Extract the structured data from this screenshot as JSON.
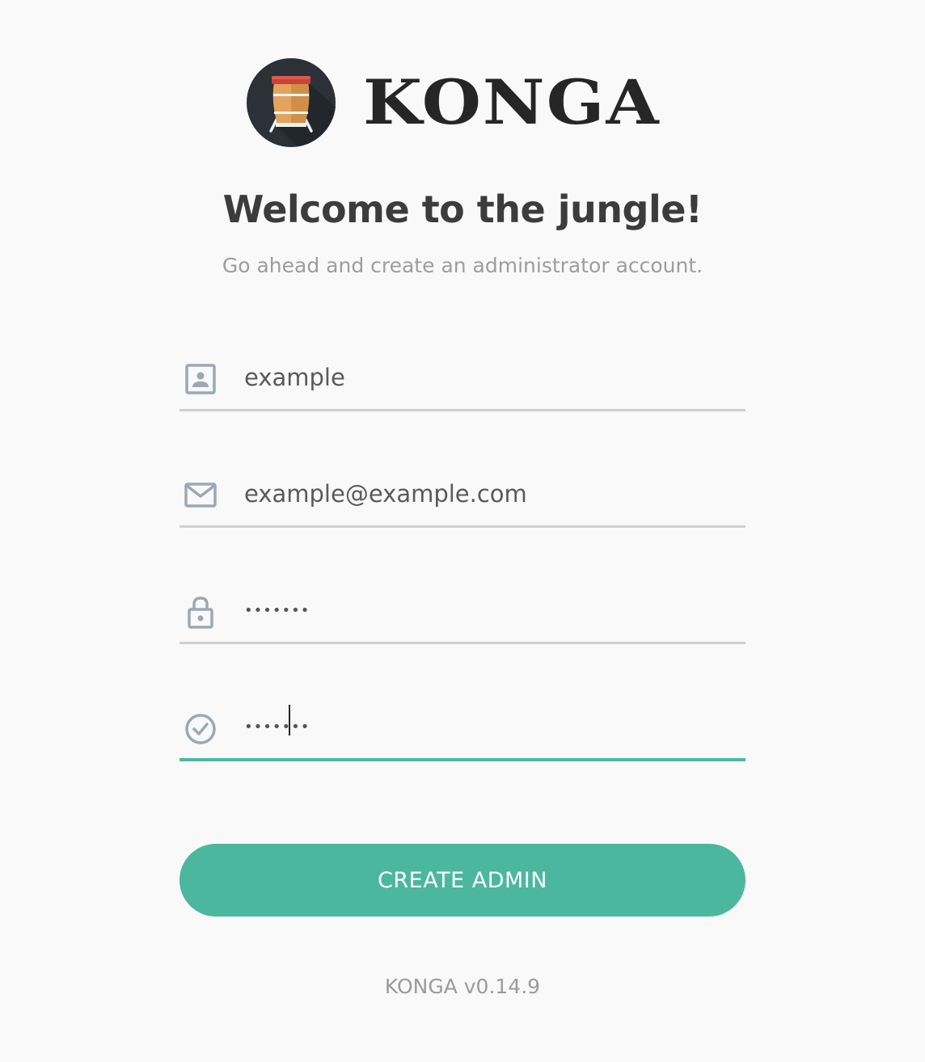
{
  "brand": {
    "name": "KONGA",
    "logo_icon": "conga-drum-icon"
  },
  "heading": {
    "title": "Welcome to the jungle!",
    "subtitle": "Go ahead and create an administrator account."
  },
  "form": {
    "username": {
      "icon": "user-card-icon",
      "value": "example"
    },
    "email": {
      "icon": "envelope-icon",
      "value": "example@example.com"
    },
    "password": {
      "icon": "lock-icon",
      "value": "•••••••"
    },
    "confirm_password": {
      "icon": "check-circle-icon",
      "value": "•••••••"
    },
    "submit_label": "CREATE ADMIN"
  },
  "footer": {
    "version": "KONGA v0.14.9"
  },
  "colors": {
    "accent": "#4bb79f",
    "background": "#f9f9f9",
    "icon": "#9aa9b3",
    "underline": "#cfcfcf",
    "logo_badge": "#2b3137",
    "drum": "#e2a45c"
  }
}
